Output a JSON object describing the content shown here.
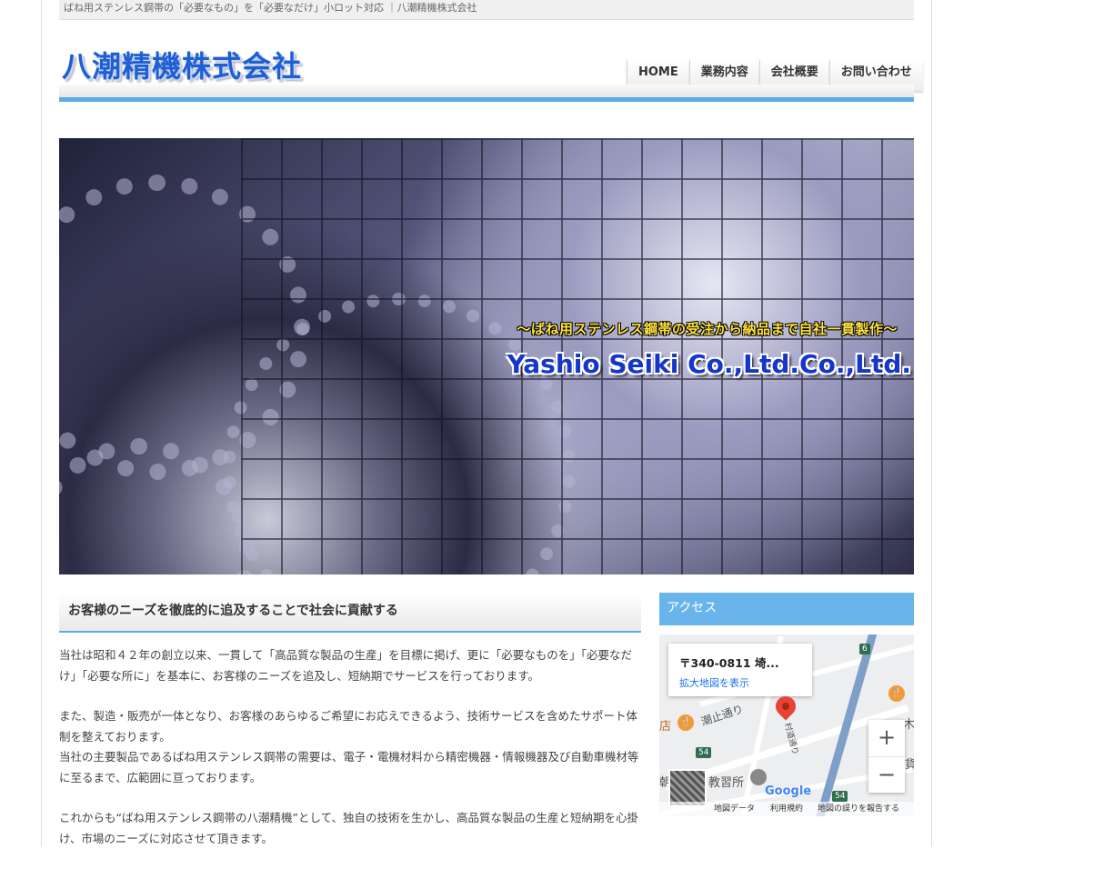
{
  "topbar": {
    "text": "ばね用ステンレス鋼帯の「必要なもの」を「必要なだけ」小ロット対応 ｜八潮精機株式会社"
  },
  "header": {
    "logo": "八潮精機株式会社"
  },
  "nav": {
    "items": [
      {
        "label": "HOME"
      },
      {
        "label": "業務内容"
      },
      {
        "label": "会社概要"
      },
      {
        "label": "お問い合わせ"
      }
    ]
  },
  "hero": {
    "tagline": "～ばね用ステンレス鋼帯の受注から納品まで自社一貫製作～",
    "company_en": "Yashio Seiki Co.,Ltd.Co.,Ltd."
  },
  "main": {
    "section_title": "お客様のニーズを徹底的に追及することで社会に貢献する",
    "paragraphs": [
      "当社は昭和４２年の創立以来、一貫して「高品質な製品の生産」を目標に掲げ、更に「必要なものを」「必要なだけ」「必要な所に」を基本に、お客様のニーズを追及し、短納期でサービスを行っております。",
      "また、製造・販売が一体となり、お客様のあらゆるご希望にお応えできるよう、技術サービスを含めたサポート体制を整えております。",
      "当社の主要製品であるばね用ステンレス鋼帯の需要は、電子・電機材料から精密機器・情報機器及び自動車機材等に至るまで、広範囲に亘っております。",
      "これからも“ばね用ステンレス鋼帯の八潮精機”として、独自の技術を生かし、高品質な製品の生産と短納期を心掛け、市場のニーズに対応させて頂きます。"
    ]
  },
  "sidebar": {
    "access_title": "アクセス",
    "map": {
      "address": "〒340-0811 埼...",
      "enlarge_link": "拡大地図を表示",
      "labels": {
        "street": "潮止通り",
        "street2": "村道通り",
        "place": "教習所",
        "store": "店",
        "kanji_left": "朝",
        "kanji_right": "木",
        "kanji_right2": "貨"
      },
      "route_54a": "54",
      "route_54b": "54",
      "route_6": "6",
      "zoom_in": "+",
      "zoom_out": "−",
      "google": "Google",
      "footer": {
        "map_data": "地図データ",
        "terms": "利用規約",
        "report": "地図の誤りを報告する"
      }
    }
  }
}
